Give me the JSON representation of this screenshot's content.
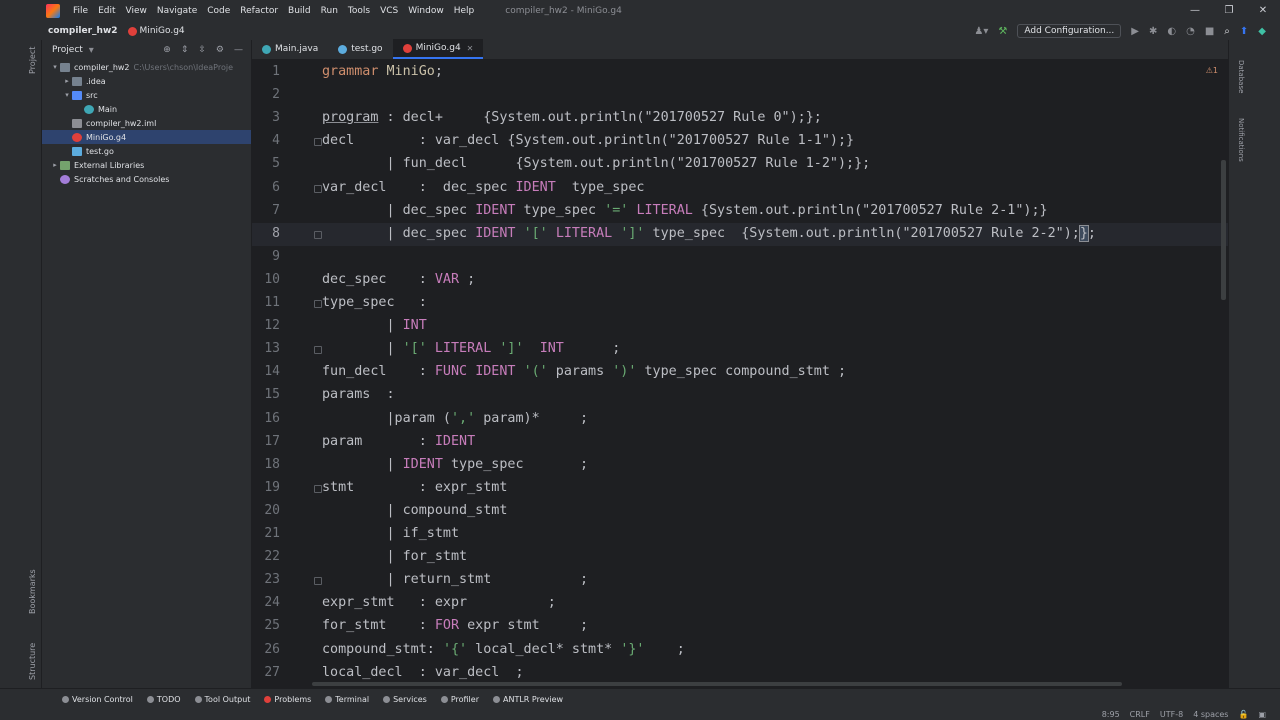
{
  "window": {
    "title": "compiler_hw2 - MiniGo.g4",
    "controls": {
      "minimize": "—",
      "restore": "❐",
      "close": "✕"
    }
  },
  "menu": [
    "File",
    "Edit",
    "View",
    "Navigate",
    "Code",
    "Refactor",
    "Build",
    "Run",
    "Tools",
    "VCS",
    "Window",
    "Help"
  ],
  "navbar": {
    "project": "compiler_hw2",
    "file": "MiniGo.g4",
    "add_config": "Add Configuration..."
  },
  "project_panel": {
    "title": "Project",
    "tree": [
      {
        "label": "compiler_hw2",
        "path": "C:\\Users\\chson\\IdeaProje",
        "depth": 0,
        "icon": "folder",
        "toggle": "▾"
      },
      {
        "label": ".idea",
        "path": "",
        "depth": 1,
        "icon": "folder",
        "toggle": "▸"
      },
      {
        "label": "src",
        "path": "",
        "depth": 1,
        "icon": "srcfolder",
        "toggle": "▾"
      },
      {
        "label": "Main",
        "path": "",
        "depth": 2,
        "icon": "class",
        "toggle": ""
      },
      {
        "label": "compiler_hw2.iml",
        "path": "",
        "depth": 1,
        "icon": "iml",
        "toggle": ""
      },
      {
        "label": "MiniGo.g4",
        "path": "",
        "depth": 1,
        "icon": "antlr",
        "toggle": "",
        "selected": true
      },
      {
        "label": "test.go",
        "path": "",
        "depth": 1,
        "icon": "gofile",
        "toggle": ""
      },
      {
        "label": "External Libraries",
        "path": "",
        "depth": 0,
        "icon": "lib",
        "toggle": "▸"
      },
      {
        "label": "Scratches and Consoles",
        "path": "",
        "depth": 0,
        "icon": "scratch",
        "toggle": ""
      }
    ]
  },
  "left_strip": {
    "project": "Project",
    "bookmarks": "Bookmarks",
    "structure": "Structure"
  },
  "right_strip": {
    "database": "Database",
    "notifications": "Notifications"
  },
  "tabs": [
    {
      "label": "Main.java",
      "color": "#3fa7b5",
      "active": false
    },
    {
      "label": "test.go",
      "color": "#5cacde",
      "active": false
    },
    {
      "label": "MiniGo.g4",
      "color": "#e0403b",
      "active": true
    }
  ],
  "editor": {
    "inspection": "⚠1",
    "lines": [
      {
        "n": "1",
        "tokens": [
          [
            "kw",
            "grammar "
          ],
          [
            "rule",
            "MiniGo"
          ],
          [
            "cm",
            ";"
          ]
        ]
      },
      {
        "n": "2",
        "tokens": []
      },
      {
        "n": "3",
        "tokens": [
          [
            "und",
            "program"
          ],
          [
            "cm",
            " : decl+     {System.out.println(\"201700527 Rule 0\");};"
          ]
        ]
      },
      {
        "n": "4",
        "tokens": [
          [
            "cm",
            "decl        : var_decl {System.out.println(\"201700527 Rule 1-1\");}"
          ]
        ]
      },
      {
        "n": "5",
        "tokens": [
          [
            "cm",
            "        | fun_decl      {System.out.println(\"201700527 Rule 1-2\");};"
          ]
        ]
      },
      {
        "n": "6",
        "tokens": [
          [
            "cm",
            "var_decl    :  dec_spec "
          ],
          [
            "tok",
            "IDENT"
          ],
          [
            "cm",
            "  type_spec"
          ]
        ]
      },
      {
        "n": "7",
        "tokens": [
          [
            "cm",
            "        | dec_spec "
          ],
          [
            "tok",
            "IDENT"
          ],
          [
            "cm",
            " type_spec "
          ],
          [
            "str",
            "'='"
          ],
          [
            "cm",
            " "
          ],
          [
            "tok",
            "LITERAL"
          ],
          [
            "cm",
            " {System.out.println(\"201700527 Rule 2-1\");}"
          ]
        ]
      },
      {
        "n": "8",
        "tokens": [
          [
            "cm",
            "        | dec_spec "
          ],
          [
            "tok",
            "IDENT"
          ],
          [
            "cm",
            " "
          ],
          [
            "str",
            "'['"
          ],
          [
            "cm",
            " "
          ],
          [
            "tok",
            "LITERAL"
          ],
          [
            "cm",
            " "
          ],
          [
            "str",
            "']'"
          ],
          [
            "cm",
            " type_spec  {System.out.println(\"201700527 Rule 2-2\");"
          ],
          [
            "caret",
            "}"
          ],
          [
            "cm",
            ";"
          ]
        ],
        "current": true
      },
      {
        "n": "9",
        "tokens": []
      },
      {
        "n": "10",
        "tokens": [
          [
            "cm",
            "dec_spec    : "
          ],
          [
            "tok",
            "VAR"
          ],
          [
            "cm",
            " ;"
          ]
        ]
      },
      {
        "n": "11",
        "tokens": [
          [
            "cm",
            "type_spec   :"
          ]
        ]
      },
      {
        "n": "12",
        "tokens": [
          [
            "cm",
            "        | "
          ],
          [
            "tok",
            "INT"
          ]
        ]
      },
      {
        "n": "13",
        "tokens": [
          [
            "cm",
            "        | "
          ],
          [
            "str",
            "'['"
          ],
          [
            "cm",
            " "
          ],
          [
            "tok",
            "LITERAL"
          ],
          [
            "cm",
            " "
          ],
          [
            "str",
            "']'"
          ],
          [
            "cm",
            "  "
          ],
          [
            "tok",
            "INT"
          ],
          [
            "cm",
            "      ;"
          ]
        ]
      },
      {
        "n": "14",
        "tokens": [
          [
            "cm",
            "fun_decl    : "
          ],
          [
            "tok",
            "FUNC"
          ],
          [
            "cm",
            " "
          ],
          [
            "tok",
            "IDENT"
          ],
          [
            "cm",
            " "
          ],
          [
            "str",
            "'('"
          ],
          [
            "cm",
            " params "
          ],
          [
            "str",
            "')'"
          ],
          [
            "cm",
            " type_spec compound_stmt ;"
          ]
        ]
      },
      {
        "n": "15",
        "tokens": [
          [
            "cm",
            "params  :"
          ]
        ]
      },
      {
        "n": "16",
        "tokens": [
          [
            "cm",
            "        |param ("
          ],
          [
            "str",
            "','"
          ],
          [
            "cm",
            " param)*     ;"
          ]
        ]
      },
      {
        "n": "17",
        "tokens": [
          [
            "cm",
            "param       : "
          ],
          [
            "tok",
            "IDENT"
          ]
        ]
      },
      {
        "n": "18",
        "tokens": [
          [
            "cm",
            "        | "
          ],
          [
            "tok",
            "IDENT"
          ],
          [
            "cm",
            " type_spec       ;"
          ]
        ]
      },
      {
        "n": "19",
        "tokens": [
          [
            "cm",
            "stmt        : expr_stmt"
          ]
        ]
      },
      {
        "n": "20",
        "tokens": [
          [
            "cm",
            "        | compound_stmt"
          ]
        ]
      },
      {
        "n": "21",
        "tokens": [
          [
            "cm",
            "        | if_stmt"
          ]
        ]
      },
      {
        "n": "22",
        "tokens": [
          [
            "cm",
            "        | for_stmt"
          ]
        ]
      },
      {
        "n": "23",
        "tokens": [
          [
            "cm",
            "        | return_stmt           ;"
          ]
        ]
      },
      {
        "n": "24",
        "tokens": [
          [
            "cm",
            "expr_stmt   : expr          ;"
          ]
        ]
      },
      {
        "n": "25",
        "tokens": [
          [
            "cm",
            "for_stmt    : "
          ],
          [
            "tok",
            "FOR"
          ],
          [
            "cm",
            " expr stmt     ;"
          ]
        ]
      },
      {
        "n": "26",
        "tokens": [
          [
            "cm",
            "compound_stmt: "
          ],
          [
            "str",
            "'{'"
          ],
          [
            "cm",
            " local_decl* stmt* "
          ],
          [
            "str",
            "'}'"
          ],
          [
            "cm",
            "    ;"
          ]
        ]
      },
      {
        "n": "27",
        "tokens": [
          [
            "cm",
            "local_decl  : var_decl  ;"
          ]
        ]
      }
    ]
  },
  "bottom_tools": [
    {
      "label": "Version Control",
      "color": "#8c8e94"
    },
    {
      "label": "TODO",
      "color": "#8c8e94"
    },
    {
      "label": "Tool Output",
      "color": "#8c8e94"
    },
    {
      "label": "Problems",
      "color": "#e0403b"
    },
    {
      "label": "Terminal",
      "color": "#8c8e94"
    },
    {
      "label": "Services",
      "color": "#8c8e94"
    },
    {
      "label": "Profiler",
      "color": "#8c8e94"
    },
    {
      "label": "ANTLR Preview",
      "color": "#8c8e94"
    }
  ],
  "status": {
    "position": "8:95",
    "line_sep": "CRLF",
    "encoding": "UTF-8",
    "indent": "4 spaces"
  }
}
